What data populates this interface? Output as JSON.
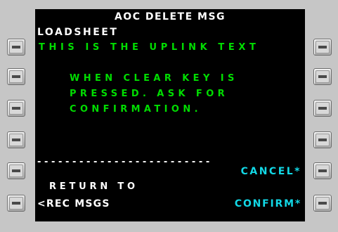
{
  "title": "AOC DELETE MSG",
  "label": "LOADSHEET",
  "uplink_text": "THIS IS THE UPLINK TEXT",
  "message_lines": [
    "WHEN CLEAR KEY IS",
    "PRESSED. ASK FOR",
    "CONFIRMATION."
  ],
  "separator": "-------------------------",
  "right_prompts": {
    "cancel": "CANCEL*",
    "confirm": "CONFIRM*"
  },
  "left_prompts": {
    "return_label": "RETURN TO",
    "return_action": "<REC MSGS"
  },
  "colors": {
    "screen_bg": "#000000",
    "header_text": "#ffffff",
    "uplink_text": "#00dd00",
    "prompt_text": "#12d8e6",
    "bezel": "#c6c6c6"
  },
  "line_select_keys": {
    "left": [
      "LSK1L",
      "LSK2L",
      "LSK3L",
      "LSK4L",
      "LSK5L",
      "LSK6L"
    ],
    "right": [
      "LSK1R",
      "LSK2R",
      "LSK3R",
      "LSK4R",
      "LSK5R",
      "LSK6R"
    ]
  }
}
